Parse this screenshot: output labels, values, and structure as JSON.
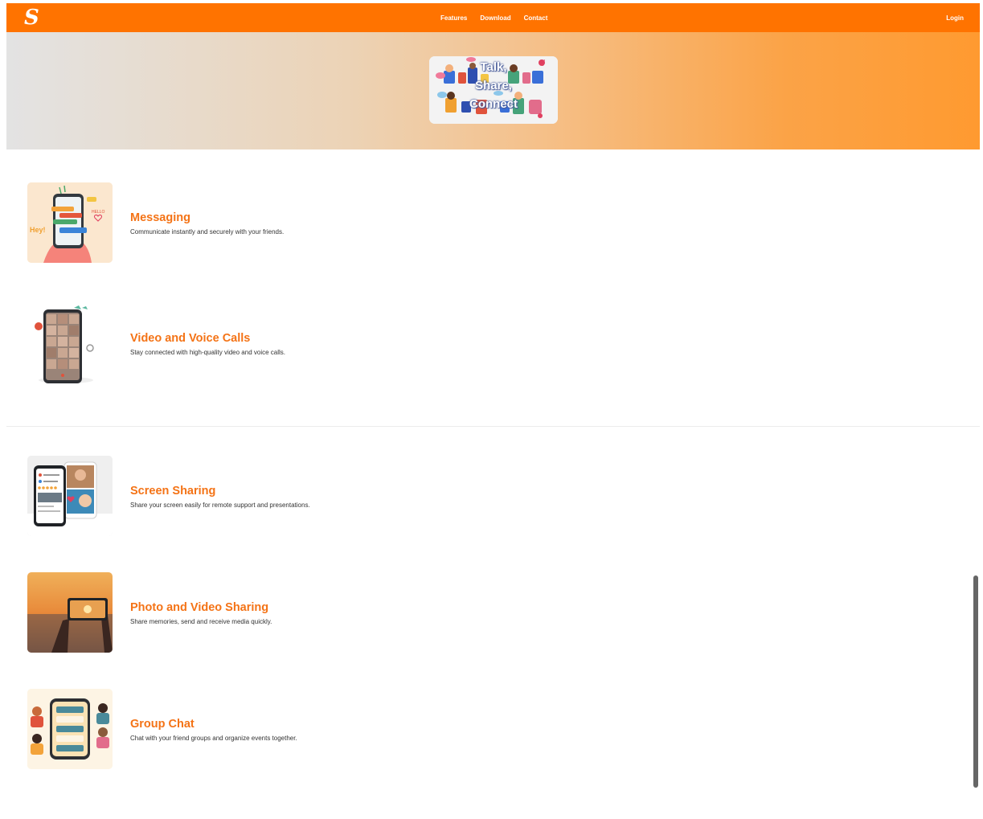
{
  "brand": {
    "logo_letter": "S",
    "accent_color": "#ff7300",
    "title_color": "#f47316"
  },
  "nav": {
    "links": [
      "Features",
      "Download",
      "Contact"
    ],
    "login_label": "Login"
  },
  "hero": {
    "lines": [
      "Talk,",
      "Share,",
      "Connect"
    ]
  },
  "features": [
    {
      "title": "Messaging",
      "description": "Communicate instantly and securely with your friends.",
      "icon": "messaging-illustration"
    },
    {
      "title": "Video and Voice Calls",
      "description": "Stay connected with high-quality video and voice calls.",
      "icon": "video-call-illustration"
    },
    {
      "title": "Screen Sharing",
      "description": "Share your screen easily for remote support and presentations.",
      "icon": "screen-sharing-illustration"
    },
    {
      "title": "Photo and Video Sharing",
      "description": "Share memories, send and receive media quickly.",
      "icon": "photo-sharing-illustration"
    },
    {
      "title": "Group Chat",
      "description": "Chat with your friend groups and organize events together.",
      "icon": "group-chat-illustration"
    }
  ]
}
